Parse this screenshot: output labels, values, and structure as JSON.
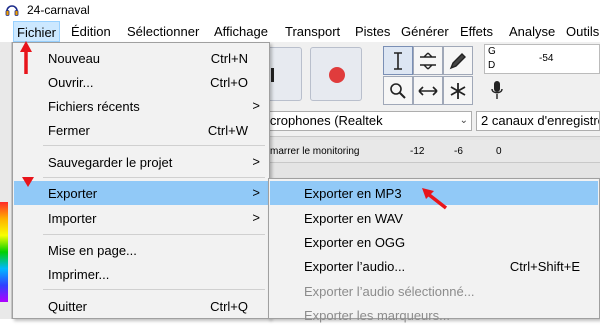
{
  "window": {
    "title": "24-carnaval"
  },
  "menubar": {
    "items": [
      "Fichier",
      "Édition",
      "Sélectionner",
      "Affichage",
      "Transport",
      "Pistes",
      "Générer",
      "Effets",
      "Analyse",
      "Outils"
    ]
  },
  "file_menu": {
    "items": [
      {
        "label": "Nouveau",
        "shortcut": "Ctrl+N"
      },
      {
        "label": "Ouvrir...",
        "shortcut": "Ctrl+O"
      },
      {
        "label": "Fichiers récents",
        "submenu": true
      },
      {
        "label": "Fermer",
        "shortcut": "Ctrl+W"
      },
      {
        "label": "Sauvegarder le projet",
        "submenu": true
      },
      {
        "label": "Exporter",
        "submenu": true,
        "highlighted": true
      },
      {
        "label": "Importer",
        "submenu": true
      },
      {
        "label": "Mise en page..."
      },
      {
        "label": "Imprimer..."
      },
      {
        "label": "Quitter",
        "shortcut": "Ctrl+Q"
      }
    ],
    "submenu_arrow": ">"
  },
  "export_submenu": {
    "items": [
      {
        "label": "Exporter en MP3",
        "highlighted": true
      },
      {
        "label": "Exporter en WAV"
      },
      {
        "label": "Exporter en OGG"
      },
      {
        "label": "Exporter l’audio...",
        "shortcut": "Ctrl+Shift+E"
      },
      {
        "label": "Exporter l’audio sélectionné...",
        "disabled": true
      },
      {
        "label": "Exporter les marqueurs...",
        "disabled": true
      }
    ]
  },
  "background": {
    "meter": {
      "g": "G",
      "d": "D",
      "tick": "-54"
    },
    "input_device": "icrophones (Realtek",
    "channels": "2 canaux d'enregistre",
    "ruler": {
      "monitor_text": "marrer le monitoring",
      "ticks": [
        "-12",
        "-6",
        "0"
      ]
    },
    "select_arrow": "⌄"
  },
  "colors": {
    "highlight": "#91c9f7",
    "annotation_red": "#e8141b",
    "record_red": "#e03c3c"
  }
}
